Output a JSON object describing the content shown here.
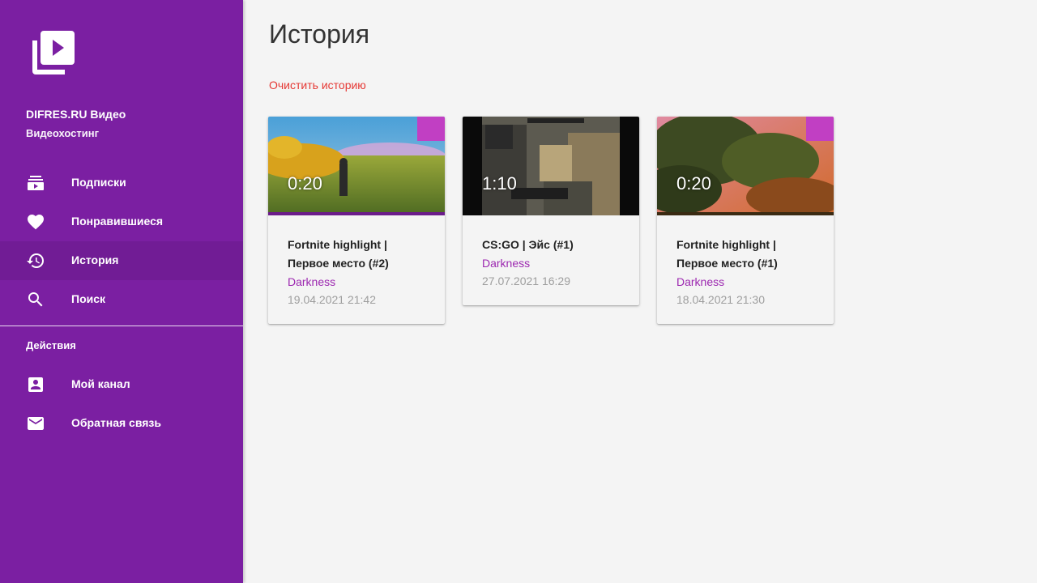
{
  "sidebar": {
    "logo_icon": "video-library-icon",
    "brand_name": "DIFRES.RU Видео",
    "brand_subtitle": "Видеохостинг",
    "items": [
      {
        "label": "Подписки",
        "icon": "subscriptions-icon"
      },
      {
        "label": "Понравившиеся",
        "icon": "heart-icon"
      },
      {
        "label": "История",
        "icon": "history-icon",
        "active": true
      },
      {
        "label": "Поиск",
        "icon": "search-icon"
      }
    ],
    "actions_title": "Действия",
    "actions": [
      {
        "label": "Мой канал",
        "icon": "account-box-icon"
      },
      {
        "label": "Обратная связь",
        "icon": "mail-icon"
      }
    ]
  },
  "main": {
    "title": "История",
    "clear_label": "Очистить историю",
    "videos": [
      {
        "duration": "0:20",
        "title": "Fortnite highlight | Первое место (#2)",
        "channel": "Darkness",
        "date": "19.04.2021 21:42"
      },
      {
        "duration": "1:10",
        "title": "CS:GO | Эйс (#1)",
        "channel": "Darkness",
        "date": "27.07.2021 16:29"
      },
      {
        "duration": "0:20",
        "title": "Fortnite highlight | Первое место (#1)",
        "channel": "Darkness",
        "date": "18.04.2021 21:30"
      }
    ]
  },
  "colors": {
    "sidebar": "#7b1fa2",
    "link_red": "#e53935",
    "channel_purple": "#9c27b0",
    "background": "#f4f4f4"
  }
}
